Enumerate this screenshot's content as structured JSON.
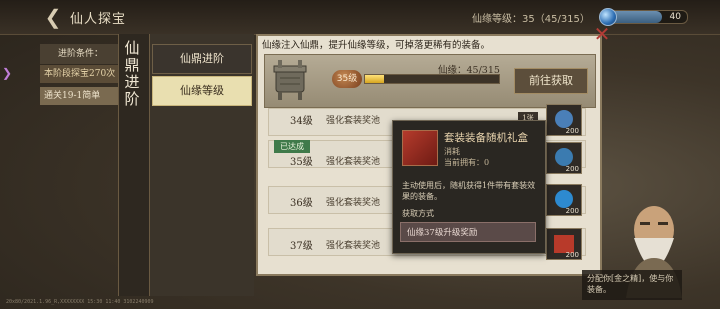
{
  "topbar": {
    "title": "仙人探宝",
    "level_text": "仙缘等级：35（45/315）",
    "bar_value": "40",
    "bar_fraction": 0.7
  },
  "left_panel": {
    "condition_label": "进阶条件：",
    "condition_value": "本阶段探宝270次",
    "condition_3": "通关19-1简单"
  },
  "vertical_title": "仙鼎进阶",
  "tabs": [
    {
      "label": "仙鼎进阶",
      "active": false
    },
    {
      "label": "仙缘等级",
      "active": true
    }
  ],
  "notice": "仙缘注入仙鼎，提升仙缘等级，可掉落更稀有的装备。",
  "level_panel": {
    "badge": "35级",
    "progress_label": "仙缘：45/315",
    "progress_fraction": 0.143,
    "goto_label": "前往获取"
  },
  "rows": [
    {
      "level": "34级",
      "desc": "强化套装奖池"
    },
    {
      "level": "35级",
      "desc": "强化套装奖池",
      "achieved": "已达成"
    },
    {
      "level": "36级",
      "desc": "强化套装奖池"
    },
    {
      "level": "37级",
      "desc": "强化套装奖池"
    }
  ],
  "right_icons": [
    {
      "count": "200",
      "color": "#4a7fb8"
    },
    {
      "count": "200",
      "color": "#3b7bb0"
    },
    {
      "count": "200",
      "color": "#2d8ad0"
    },
    {
      "count": "200",
      "color": "#b83a2a"
    }
  ],
  "tag_label": "1张",
  "tooltip": {
    "name": "套装装备随机礼盒",
    "type": "消耗",
    "owned": "当前拥有：0",
    "desc": "主动使用后，随机获得1件带有套装效果的装备。",
    "source_label": "获取方式",
    "source": "仙缘37级升级奖励"
  },
  "speech": "分配你[金之精]，使与你装备。",
  "footer": "20x80/2021.1.96_R,XXXXXXXX 15:30 11:40 3102240909"
}
